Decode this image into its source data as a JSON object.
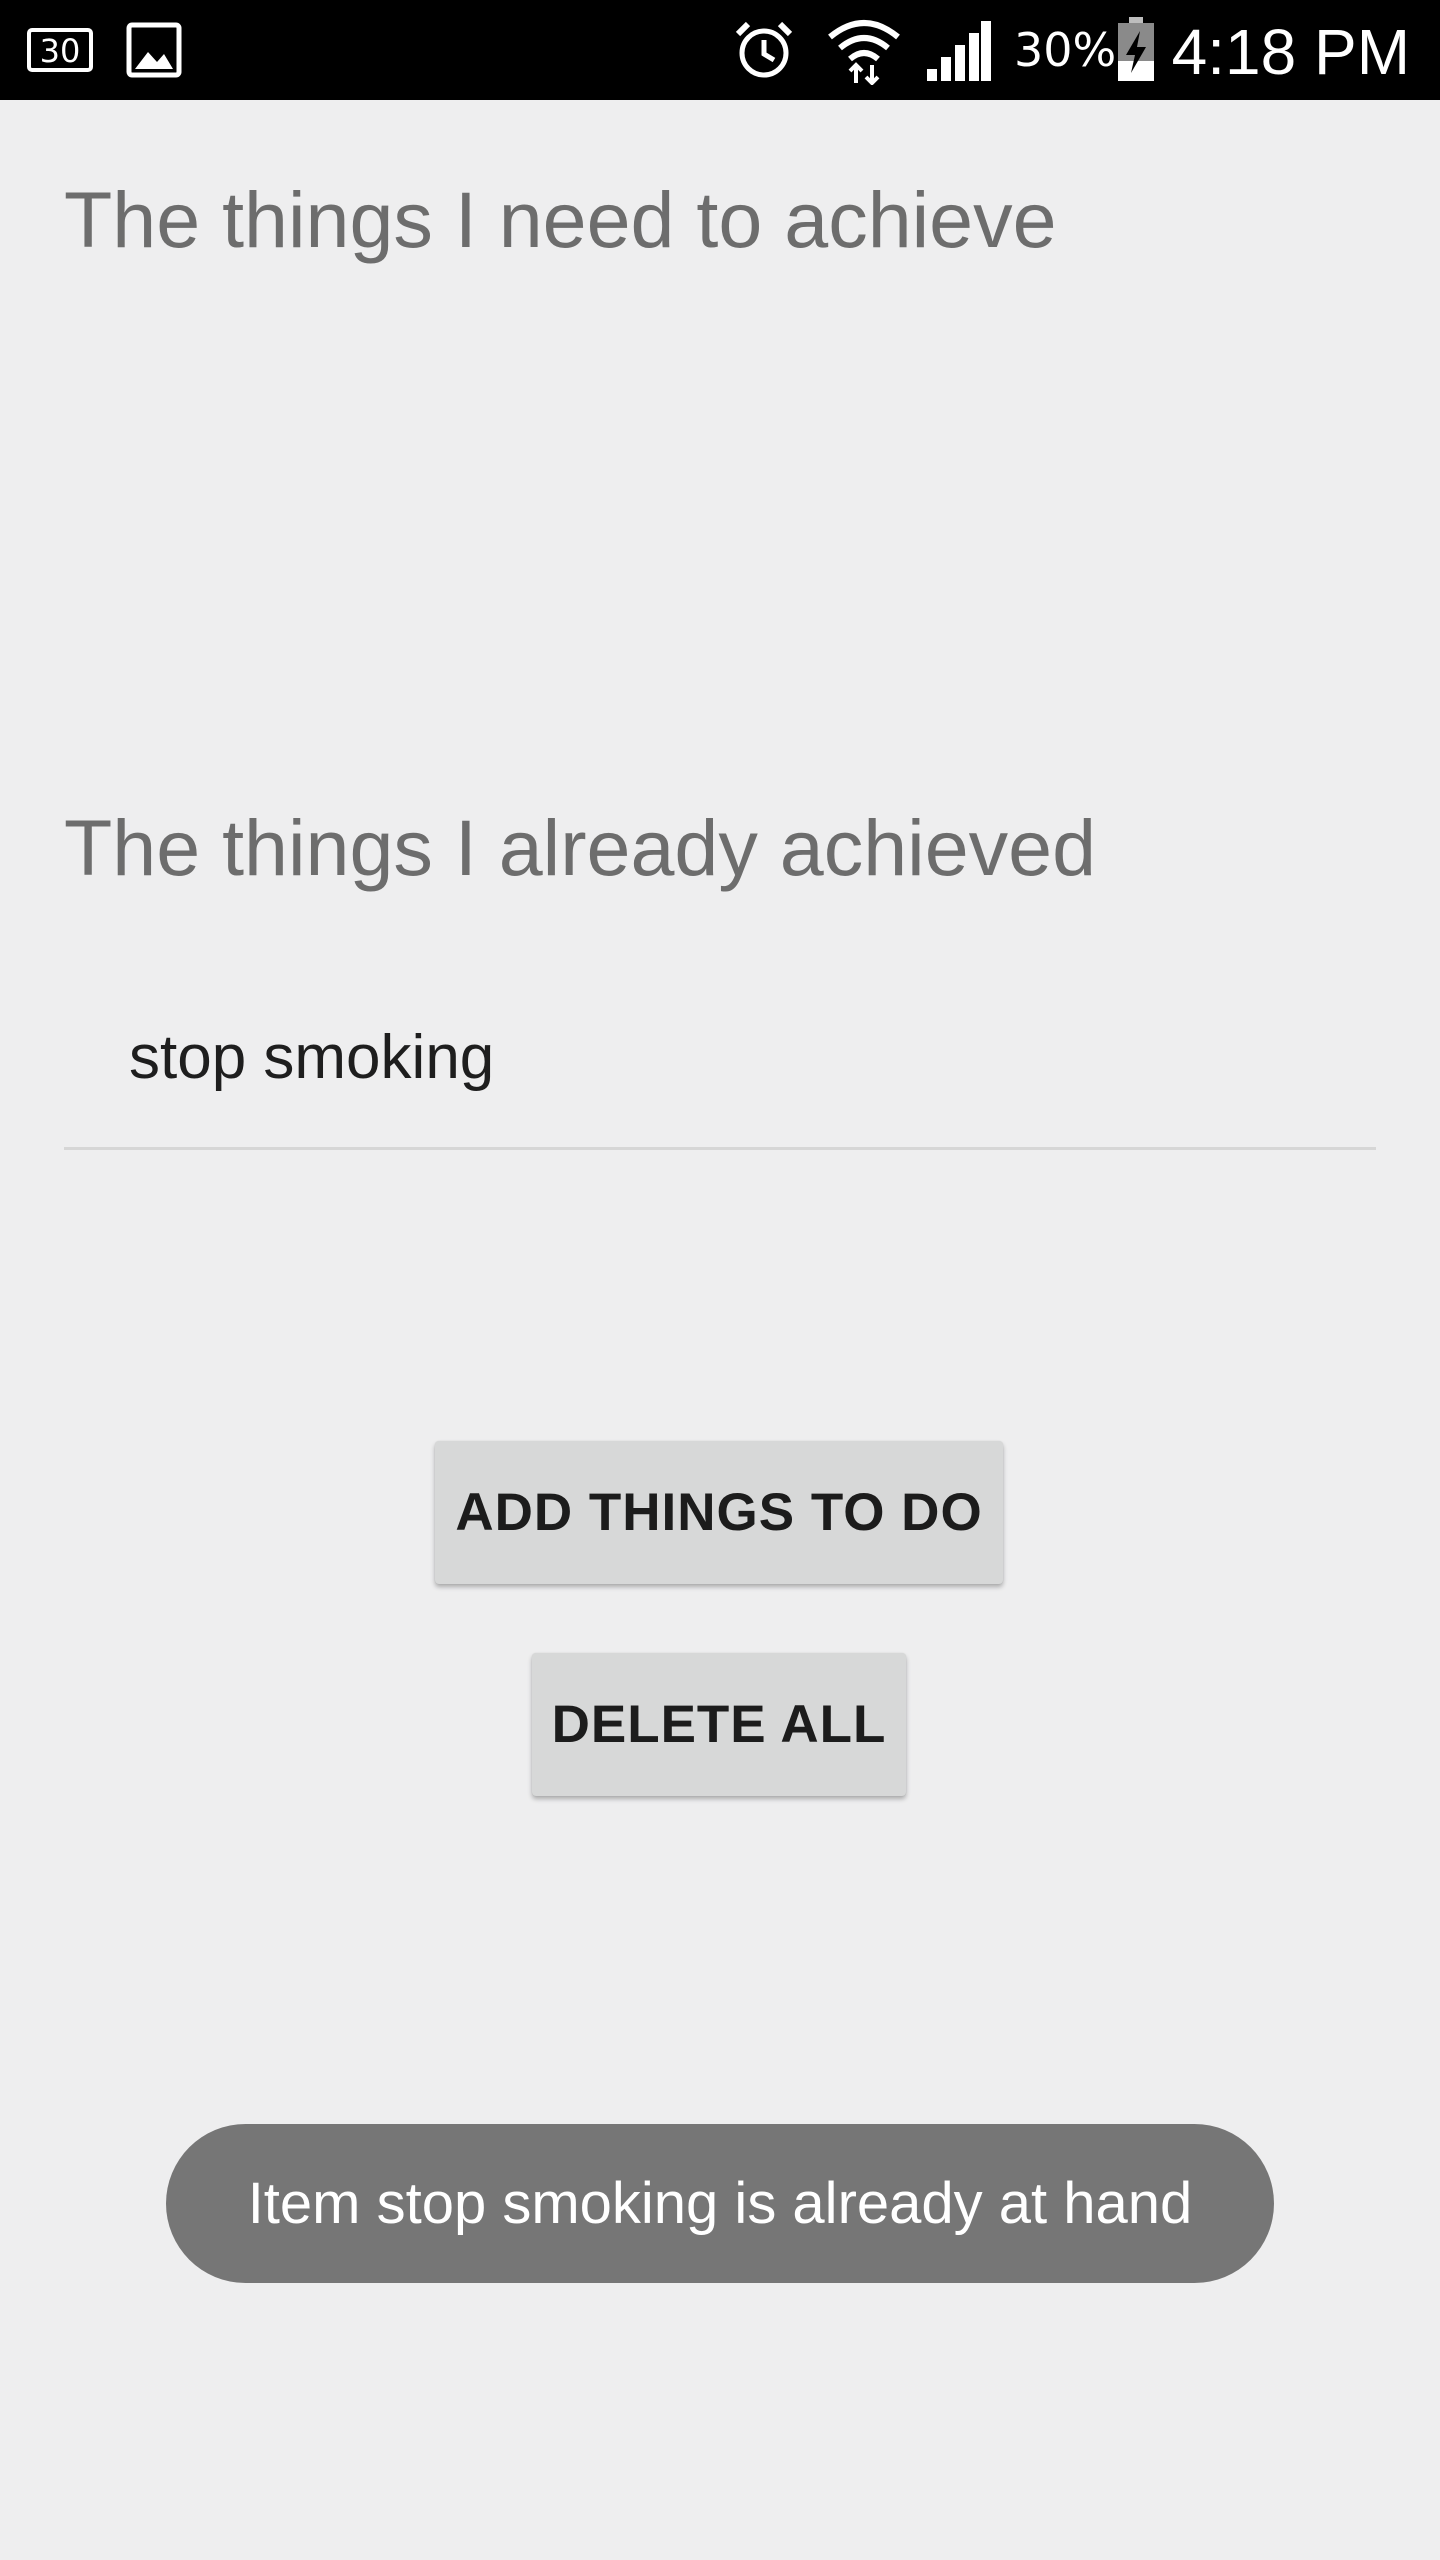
{
  "status_bar": {
    "notification_icons": [
      "thirty-day-calendar-icon",
      "image-icon"
    ],
    "system_icons": [
      "alarm-icon",
      "wifi-icon",
      "signal-icon",
      "battery-charging-icon"
    ],
    "battery_percent": "30%",
    "time": "4:18 PM"
  },
  "todo_section": {
    "heading": "The things I need to achieve",
    "items": []
  },
  "done_section": {
    "heading": "The things I already achieved",
    "items": [
      {
        "label": "stop smoking"
      }
    ]
  },
  "actions": {
    "add_label": "ADD THINGS TO DO",
    "delete_label": "DELETE ALL"
  },
  "toast": {
    "message": "Item stop smoking is already at hand"
  },
  "colors": {
    "background": "#eeeeef",
    "heading": "#6d6d6d",
    "button": "#d7d8d8",
    "toast": "#767676"
  }
}
